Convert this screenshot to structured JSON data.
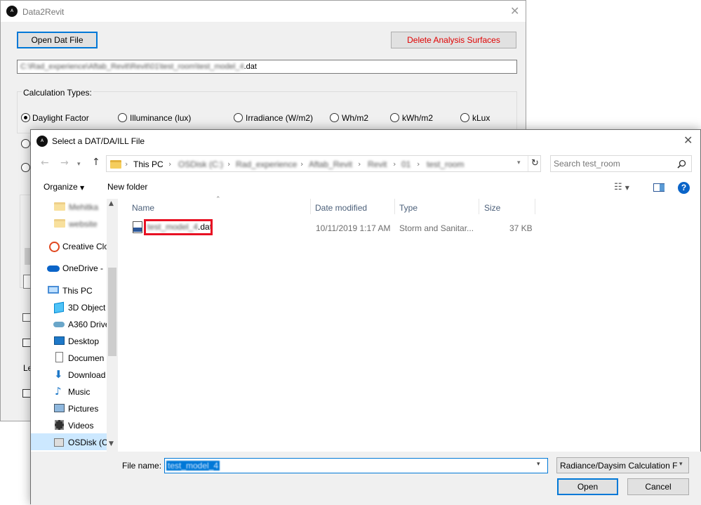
{
  "main": {
    "title": "Data2Revit",
    "open_button": "Open Dat File",
    "delete_button": "Delete Analysis Surfaces",
    "path_blurred": "C:\\Rad_experience\\Aftab_Revit\\Revit\\01\\test_room\\test_model_4",
    "path_ext": ".dat",
    "calc_types_label": "Calculation Types:",
    "radios": [
      {
        "label": "Daylight Factor",
        "checked": true
      },
      {
        "label": "Illuminance (lux)",
        "checked": false
      },
      {
        "label": "Irradiance (W/m2)",
        "checked": false
      },
      {
        "label": "Wh/m2",
        "checked": false
      },
      {
        "label": "kWh/m2",
        "checked": false
      },
      {
        "label": "kLux",
        "checked": false
      }
    ],
    "partial_label": "Le"
  },
  "dialog": {
    "title": "Select a DAT/DA/ILL File",
    "breadcrumb": [
      "This PC",
      "OSDisk (C:)",
      "Rad_experience",
      "Aftab_Revit",
      "Revit",
      "01",
      "test_room"
    ],
    "search_placeholder": "Search test_room",
    "toolbar": {
      "organize": "Organize",
      "new_folder": "New folder"
    },
    "nav_items": [
      {
        "label": "Mehitka",
        "icon": "folder-icon",
        "blurred": true
      },
      {
        "label": "website",
        "icon": "folder-icon",
        "blurred": true
      },
      {
        "label": "Creative Clo",
        "icon": "creative-cloud-icon"
      },
      {
        "label": "OneDrive -",
        "icon": "onedrive-icon"
      },
      {
        "label": "This PC",
        "icon": "computer-icon"
      },
      {
        "label": "3D Object",
        "icon": "3d-objects-icon"
      },
      {
        "label": "A360 Drive",
        "icon": "a360-drive-icon"
      },
      {
        "label": "Desktop",
        "icon": "desktop-icon"
      },
      {
        "label": "Documen",
        "icon": "documents-icon"
      },
      {
        "label": "Download",
        "icon": "downloads-icon"
      },
      {
        "label": "Music",
        "icon": "music-icon"
      },
      {
        "label": "Pictures",
        "icon": "pictures-icon"
      },
      {
        "label": "Videos",
        "icon": "videos-icon"
      },
      {
        "label": "OSDisk (C",
        "icon": "disk-icon"
      }
    ],
    "columns": [
      "Name",
      "Date modified",
      "Type",
      "Size"
    ],
    "file": {
      "name_blurred": "test_model_4",
      "ext": ".dat",
      "date": "10/11/2019 1:17 AM",
      "type": "Storm and Sanitar...",
      "size": "37 KB"
    },
    "file_name_label": "File name:",
    "file_name_value": "test_model_4",
    "filter": "Radiance/Daysim Calculation F",
    "open_button": "Open",
    "cancel_button": "Cancel"
  },
  "colors": {
    "accent": "#0078d7",
    "highlight": "#e81123",
    "delete_text": "#e00000"
  }
}
